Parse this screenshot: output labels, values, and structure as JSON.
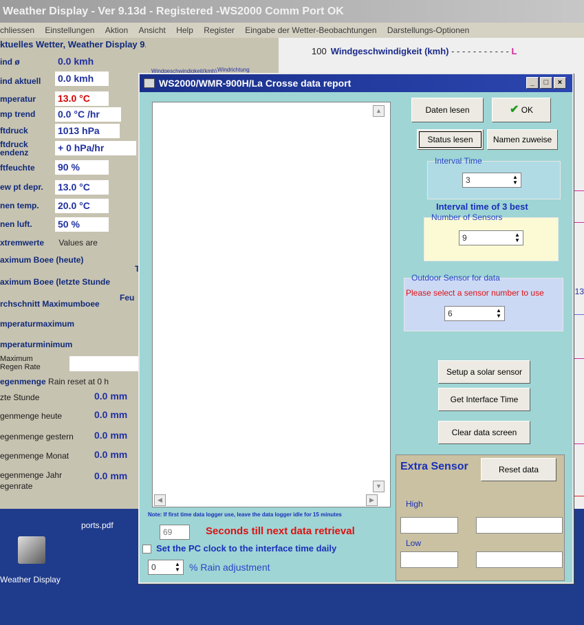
{
  "main_window": {
    "title": "Weather Display - Ver 9.13d - Registered  -WS2000 Comm Port OK",
    "menu": [
      "chliessen",
      "Einstellungen",
      "Aktion",
      "Ansicht",
      "Help",
      "Register",
      "Eingabe der Wetter-Beobachtungen",
      "Darstellungs-Optionen"
    ],
    "panel_header": "ktuelles Wetter, Weather Display 9.13d",
    "rows": [
      {
        "label": "ind ø",
        "value": "0.0 kmh"
      },
      {
        "label": "ind aktuell",
        "value": "0.0 kmh"
      },
      {
        "label": "mperatur",
        "value": "13.0 °C"
      },
      {
        "label": "mp trend",
        "value": "0.0 °C /hr"
      },
      {
        "label": "ftdruck",
        "value": "1013 hPa"
      },
      {
        "label": "ftdruck",
        "label2": "endenz",
        "value": "+ 0 hPa/hr"
      },
      {
        "label": "ftfeuchte",
        "value": "90 %"
      },
      {
        "label": "ew pt depr.",
        "value": "13.0 °C"
      },
      {
        "label": "nen temp.",
        "value": "20.0 °C"
      },
      {
        "label": "nen luft.",
        "value": "50 %"
      }
    ],
    "extremes_title": "xtremwerte",
    "extremes_note": "Values are",
    "extremes": [
      "aximum Boee (heute)",
      "aximum Boee (letzte Stunde",
      "rchschnitt Maximumboee",
      "mperaturmaximum",
      "mperaturminimum"
    ],
    "max_rain_rate": [
      "Maximum",
      "Regen Rate"
    ],
    "rain_title": "egenmenge",
    "rain_note": "Rain reset at 0 h",
    "rain_rows": [
      {
        "label": "zte Stunde",
        "value": "0.0 mm"
      },
      {
        "label": "genmenge heute",
        "value": "0.0 mm"
      },
      {
        "label": "egenmenge gestern",
        "value": "0.0 mm"
      },
      {
        "label": "egenmenge Monat",
        "value": "0.0 mm"
      },
      {
        "label": "egenmenge Jahr",
        "value": "0.0 mm"
      }
    ],
    "rain_rate_label": "egenrate",
    "gauge_labels": [
      "Windgeschwindigkeit(kmh)",
      "Windrichtung"
    ],
    "side_right_labels": [
      "T",
      "Feu"
    ],
    "graph_ytick": "100",
    "graph_title": "Windgeschwindigkeit (kmh)",
    "graph_edge_letter": "L",
    "graph_edge_number": "13"
  },
  "desktop": {
    "icon_label": "Weather Display",
    "ports_label": "ports.pdf"
  },
  "dialog": {
    "title": "WS2000/WMR-900H/La Crosse data report",
    "buttons": {
      "read_data": "Daten lesen",
      "ok": "OK",
      "read_status": "Status lesen",
      "assign_names": "Namen zuweise",
      "setup_solar": "Setup a solar sensor",
      "get_time": "Get Interface Time",
      "clear": "Clear data screen",
      "reset": "Reset data"
    },
    "interval": {
      "title": "Interval Time",
      "value": "3",
      "note": "Interval time of 3 best"
    },
    "sensors": {
      "title": "Number of Sensors",
      "value": "9"
    },
    "outdoor": {
      "title": "Outdoor Sensor for data",
      "note": "Please select a sensor number to use",
      "value": "6"
    },
    "extra": {
      "title": "Extra Sensor",
      "high": "High",
      "low": "Low"
    },
    "note": "Note: If first time data logger use, leave the data logger idle for 15 minutes",
    "countdown": {
      "value": "69",
      "label": "Seconds till next data retrieval"
    },
    "set_clock": "Set the PC clock to the interface time daily",
    "rain_adjust": {
      "value": "0",
      "label": "% Rain adjustment"
    }
  }
}
